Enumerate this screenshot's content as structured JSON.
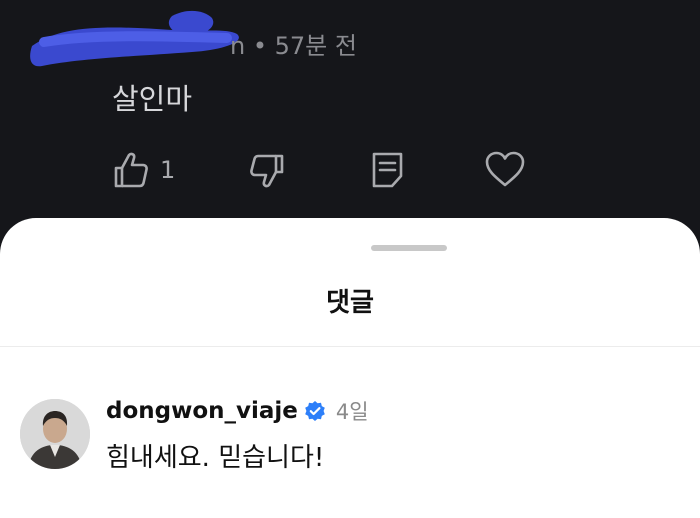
{
  "comment": {
    "meta_tail": "n • 57분 전",
    "text": "살인마",
    "like_count": "1",
    "icons": [
      "thumbs-up-icon",
      "thumbs-down-icon",
      "reply-icon",
      "heart-icon"
    ]
  },
  "sheet": {
    "title": "댓글"
  },
  "reply": {
    "username": "dongwon_viaje",
    "time": "4일",
    "text": "힘내세요. 믿습니다!",
    "verified_color": "#2d7ff9"
  },
  "colors": {
    "dark_bg": "#15161a",
    "scribble": "#3e4fd8",
    "sheet_bg": "#ffffff"
  }
}
